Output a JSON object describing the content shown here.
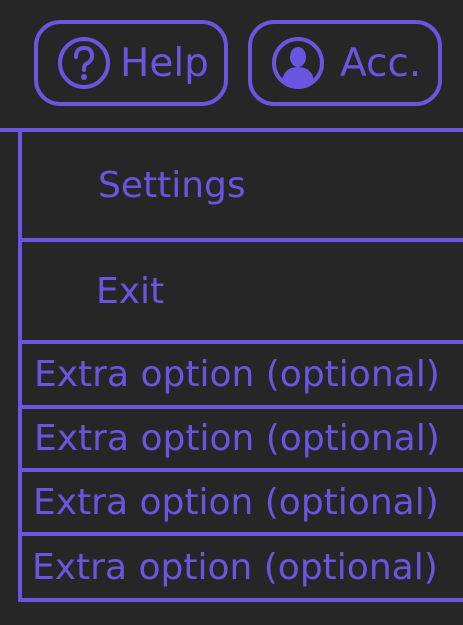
{
  "header": {
    "help_label": "Help",
    "account_label": "Acc."
  },
  "menu": {
    "settings_label": "Settings",
    "exit_label": "Exit",
    "extra_options": [
      "Extra option (optional)",
      "Extra option (optional)",
      "Extra option (optional)",
      "Extra option (optional)"
    ]
  },
  "theme": {
    "accent": "#6a55e0",
    "background": "#262626"
  },
  "icons": {
    "help": "question-circle-icon",
    "account": "user-circle-icon"
  }
}
